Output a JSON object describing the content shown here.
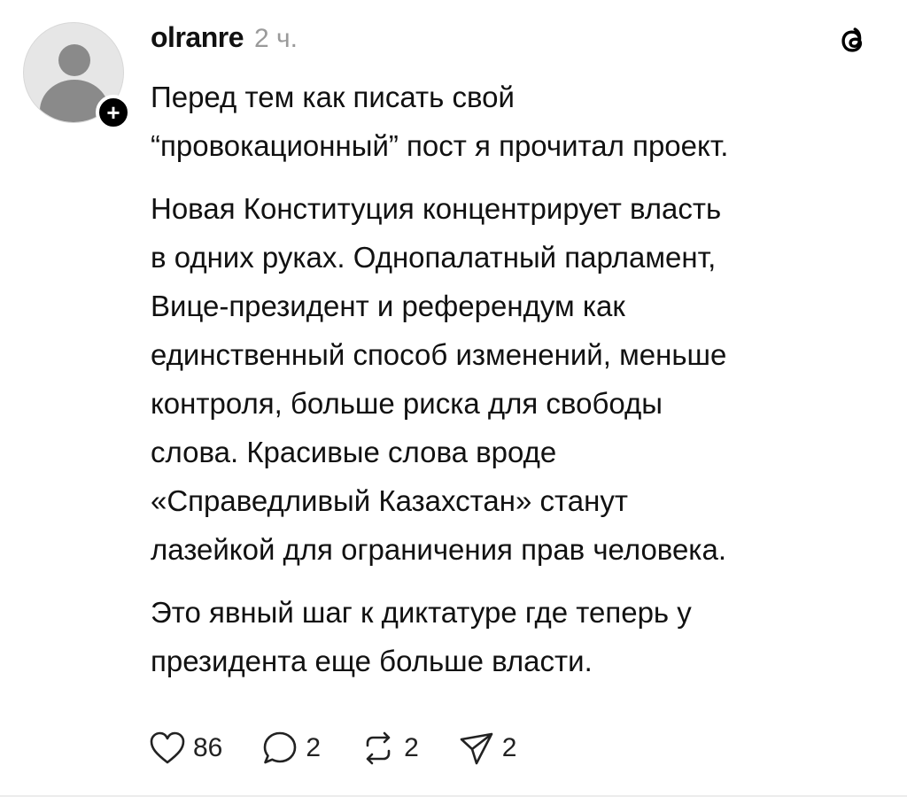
{
  "post": {
    "username": "olranre",
    "time": "2 ч.",
    "paragraphs": [
      [
        "Перед тем как писать свой",
        "“провокационный” пост я прочитал проект."
      ],
      [
        "Новая Конституция концентрирует власть",
        "в одних руках. Однопалатный парламент,",
        "Вице-президент и референдум как",
        "единственный способ изменений, меньше",
        "контроля, больше риска для свободы",
        "слова. Красивые слова вроде",
        "«Справедливый Казахстан» станут",
        "лазейкой для ограничения прав человека."
      ],
      [
        "Это явный шаг к диктатуре где теперь у",
        "президента еще больше власти."
      ]
    ],
    "actions": {
      "likes": "86",
      "replies": "2",
      "reposts": "2",
      "shares": "2"
    },
    "icons": {
      "like": "heart-icon",
      "reply": "comment-icon",
      "repost": "repost-icon",
      "share": "send-icon",
      "app": "threads-logo-icon",
      "follow": "plus-icon"
    }
  }
}
